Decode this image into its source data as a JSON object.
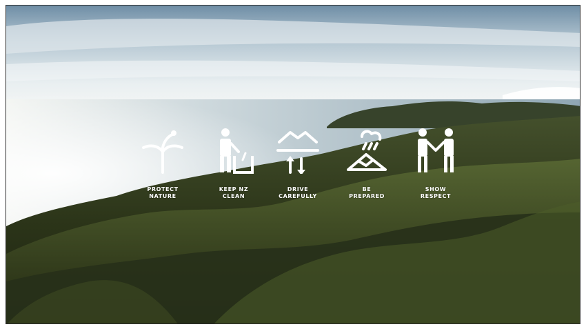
{
  "pledges": [
    {
      "label": "PROTECT\nNATURE",
      "icon": "fern-tree-icon"
    },
    {
      "label": "KEEP NZ\nCLEAN",
      "icon": "person-rubbish-bin-icon"
    },
    {
      "label": "DRIVE\nCAREFULLY",
      "icon": "road-arrows-icon"
    },
    {
      "label": "BE\nPREPARED",
      "icon": "mountain-weather-icon"
    },
    {
      "label": "SHOW\nRESPECT",
      "icon": "two-people-handshake-icon"
    }
  ],
  "colors": {
    "icon": "#ffffff",
    "sky_top": "#6f8fa6",
    "sky_horizon": "#eaf0f2",
    "sea": "#c7d4da",
    "hills": "#2f3a1f"
  }
}
